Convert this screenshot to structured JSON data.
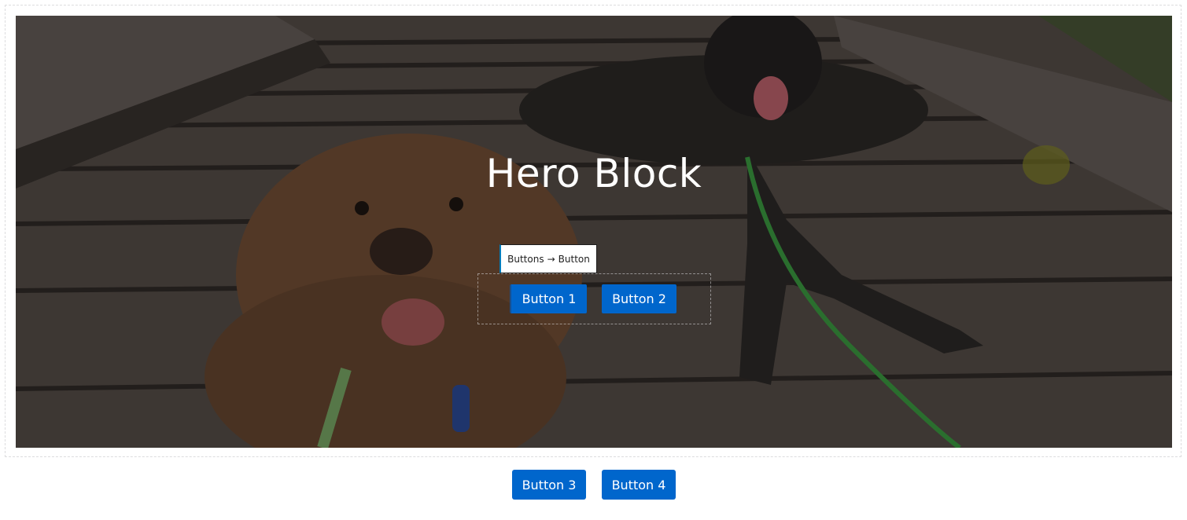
{
  "hero": {
    "title": "Hero Block",
    "image_alt": "Two dogs lying on a wooden boardwalk: a curly brown dog in front and a dark shepherd with a green leash behind"
  },
  "block_toolbar": {
    "parent": "Buttons",
    "separator": "→",
    "current": "Button"
  },
  "hero_buttons": [
    "Button 1",
    "Button 2"
  ],
  "footer_buttons": [
    "Button 3",
    "Button 4"
  ],
  "colors": {
    "button_bg": "#0066cc",
    "button_text": "#ffffff",
    "selection_accent": "#007cba"
  }
}
